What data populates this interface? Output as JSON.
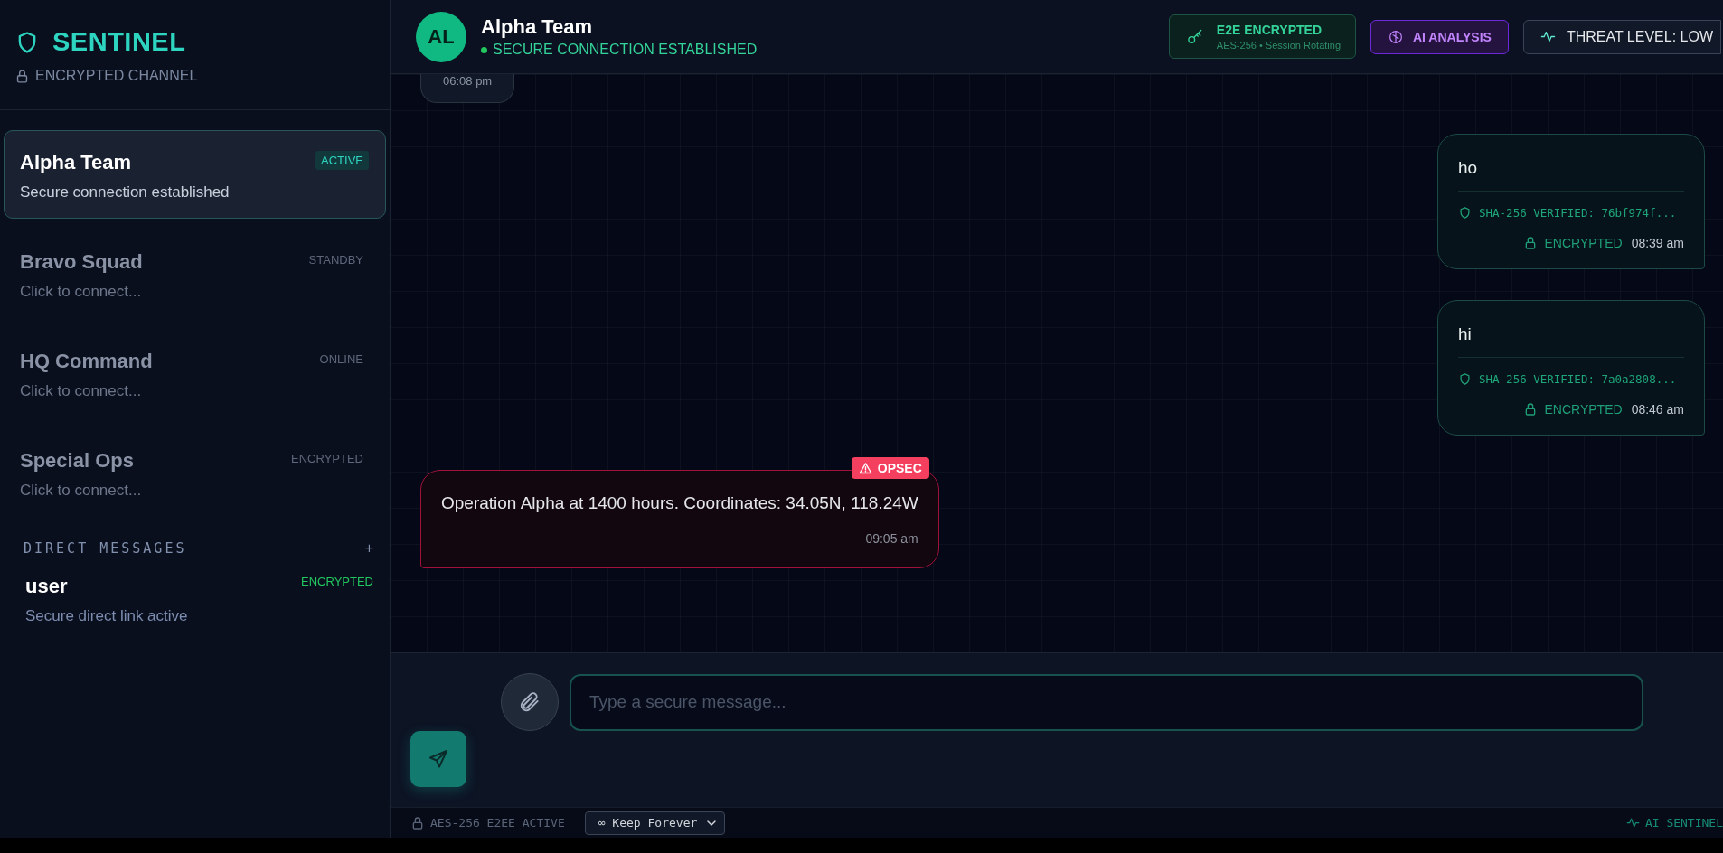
{
  "brand": {
    "title": "SENTINEL",
    "subtitle": "ENCRYPTED CHANNEL"
  },
  "channels": [
    {
      "name": "Alpha Team",
      "preview": "Secure connection established",
      "status": "ACTIVE",
      "selected": true
    },
    {
      "name": "Bravo Squad",
      "preview": "Click to connect...",
      "status": "STANDBY",
      "selected": false
    },
    {
      "name": "HQ Command",
      "preview": "Click to connect...",
      "status": "ONLINE",
      "selected": false
    },
    {
      "name": "Special Ops",
      "preview": "Click to connect...",
      "status": "ENCRYPTED",
      "selected": false
    }
  ],
  "direct_messages": {
    "heading": "DIRECT MESSAGES",
    "add": "+",
    "items": [
      {
        "name": "user",
        "preview": "Secure direct link active",
        "status": "ENCRYPTED",
        "selected": false
      }
    ]
  },
  "header": {
    "avatar": "AL",
    "title": "Alpha Team",
    "status": "SECURE CONNECTION ESTABLISHED",
    "badges": [
      {
        "kind": "encryption",
        "title": "E2E ENCRYPTED",
        "subtitle": "AES-256 • Session Rotating"
      },
      {
        "kind": "ai",
        "label": "AI ANALYSIS"
      },
      {
        "kind": "threat",
        "label": "THREAT LEVEL: LOW"
      }
    ]
  },
  "messages": [
    {
      "kind": "incoming",
      "time": "06:08 pm"
    },
    {
      "kind": "outgoing",
      "text": "ho",
      "hash": "SHA-256 VERIFIED: 76bf974f...",
      "security": "ENCRYPTED",
      "time": "08:39 am"
    },
    {
      "kind": "outgoing",
      "text": "hi",
      "hash": "SHA-256 VERIFIED: 7a0a2808...",
      "security": "ENCRYPTED",
      "time": "08:46 am"
    },
    {
      "kind": "flagged",
      "flag": "OPSEC",
      "text": "Operation Alpha at 1400 hours. Coordinates: 34.05N, 118.24W",
      "time": "09:05 am"
    }
  ],
  "composer": {
    "placeholder": "Type a secure message..."
  },
  "status_bar": {
    "encryption": "AES-256 E2EE ACTIVE",
    "retention": "∞ Keep Forever",
    "ai": "AI SENTINEL"
  }
}
